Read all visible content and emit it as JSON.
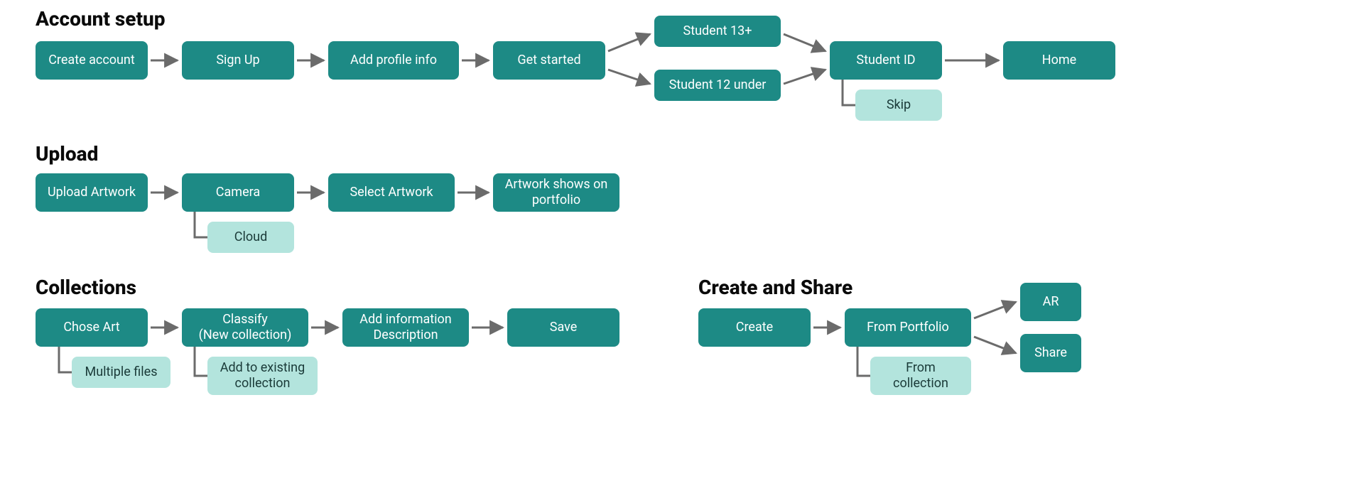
{
  "colors": {
    "primary": "#1d8a85",
    "alt": "#b3e4dd",
    "arrow": "#6b6b6b",
    "text_title": "#0a0a0a"
  },
  "sections": {
    "account_setup": {
      "title": "Account setup",
      "nodes": {
        "create_account": "Create account",
        "sign_up": "Sign Up",
        "add_profile": "Add profile info",
        "get_started": "Get started",
        "student_13plus": "Student 13+",
        "student_12under": "Student 12 under",
        "student_id": "Student ID",
        "skip": "Skip",
        "home": "Home"
      }
    },
    "upload": {
      "title": "Upload",
      "nodes": {
        "upload_artwork": "Upload Artwork",
        "camera": "Camera",
        "cloud": "Cloud",
        "select_artwork": "Select Artwork",
        "artwork_shows": "Artwork shows on portfolio"
      }
    },
    "collections": {
      "title": "Collections",
      "nodes": {
        "chose_art": "Chose Art",
        "multiple_files": "Multiple files",
        "classify": "Classify\n(New collection)",
        "add_existing": "Add to existing collection",
        "add_info": "Add information Description",
        "save": "Save"
      }
    },
    "create_share": {
      "title": "Create and Share",
      "nodes": {
        "create": "Create",
        "from_portfolio": "From Portfolio",
        "from_collection": "From collection",
        "ar": "AR",
        "share": "Share"
      }
    }
  }
}
